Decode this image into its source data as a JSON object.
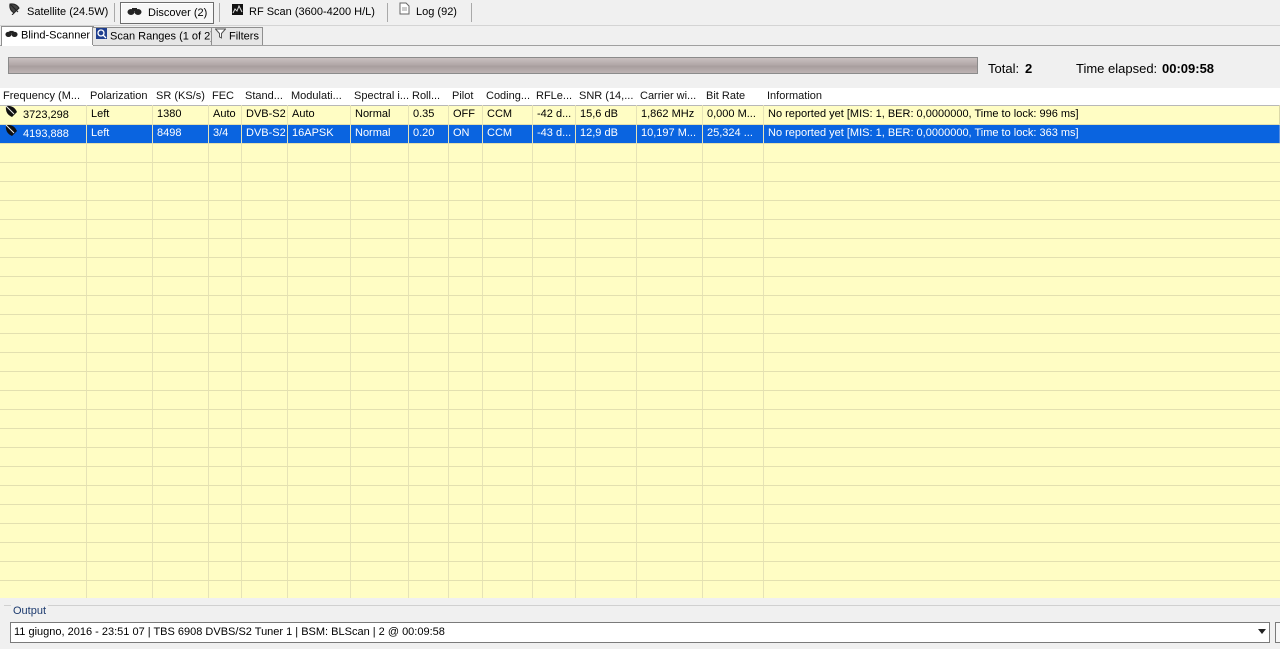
{
  "toolbar": {
    "satellite": "Satellite (24.5W)",
    "discover": "Discover (2)",
    "rfscan": "RF Scan (3600-4200 H/L)",
    "log": "Log (92)"
  },
  "tabs": {
    "blind_scanner": "Blind-Scanner",
    "scan_ranges": "Scan Ranges (1 of 2)",
    "filters": "Filters"
  },
  "status": {
    "total_label": "Total:",
    "total_value": "2",
    "elapsed_label": "Time elapsed:",
    "elapsed_value": "00:09:58",
    "progress_fraction": 1.0
  },
  "grid": {
    "columns": [
      "Frequency (M...",
      "Polarization",
      "SR (KS/s)",
      "FEC",
      "Stand...",
      "Modulati...",
      "Spectral i...",
      "Roll...",
      "Pilot",
      "Coding...",
      "RFLe...",
      "SNR (14,...",
      "Carrier wi...",
      "Bit Rate",
      "Information"
    ],
    "rows": [
      [
        "3723,298",
        "Left",
        "1380",
        "Auto",
        "DVB-S2",
        "Auto",
        "Normal",
        "0.35",
        "OFF",
        "CCM",
        "-42 d...",
        "15,6 dB",
        "1,862 MHz",
        "0,000 M...",
        "No reported yet [MIS: 1, BER: 0,0000000, Time to lock: 996 ms]"
      ],
      [
        "4193,888",
        "Left",
        "8498",
        "3/4",
        "DVB-S2",
        "16APSK",
        "Normal",
        "0.20",
        "ON",
        "CCM",
        "-43 d...",
        "12,9 dB",
        "10,197 M...",
        "25,324 ...",
        "No reported yet [MIS: 1, BER: 0,0000000, Time to lock: 363 ms]"
      ]
    ],
    "selected_row": 1,
    "row_color": "#fffdc4",
    "selected_color": "#0a64e0"
  },
  "output": {
    "label": "Output",
    "value": "11 giugno, 2016 - 23:51 07 | TBS 6908 DVBS/S2 Tuner 1 | BSM: BLScan | 2 @ 00:09:58"
  },
  "icons": {
    "satellite": "satellite-dish-icon",
    "discover": "binoculars-icon",
    "rfscan": "spectrum-icon",
    "log": "document-icon",
    "scan_ranges": "magnifier-icon",
    "filters": "funnel-icon",
    "row": "dish-icon"
  }
}
